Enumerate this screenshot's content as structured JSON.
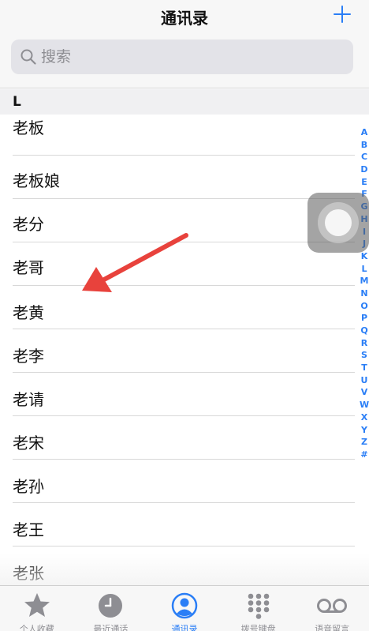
{
  "nav": {
    "title": "通讯录",
    "add_icon": "plus-icon"
  },
  "search": {
    "placeholder": "搜索",
    "value": "",
    "icon": "search-icon"
  },
  "section": {
    "letter": "L"
  },
  "contacts": [
    {
      "name": "老板"
    },
    {
      "name": "老板娘"
    },
    {
      "name": "老分"
    },
    {
      "name": "老哥"
    },
    {
      "name": "老黄"
    },
    {
      "name": "老李"
    },
    {
      "name": "老请"
    },
    {
      "name": "老宋"
    },
    {
      "name": "老孙"
    },
    {
      "name": "老王"
    },
    {
      "name": "老张"
    }
  ],
  "index_letters": [
    "A",
    "B",
    "C",
    "D",
    "E",
    "F",
    "G",
    "H",
    "I",
    "J",
    "K",
    "L",
    "M",
    "N",
    "O",
    "P",
    "Q",
    "R",
    "S",
    "T",
    "U",
    "V",
    "W",
    "X",
    "Y",
    "Z",
    "#"
  ],
  "tabs": [
    {
      "label": "个人收藏",
      "icon": "star-icon",
      "active": false
    },
    {
      "label": "最近通话",
      "icon": "clock-icon",
      "active": false
    },
    {
      "label": "通讯录",
      "icon": "person-circle-icon",
      "active": true
    },
    {
      "label": "拨号键盘",
      "icon": "keypad-icon",
      "active": false
    },
    {
      "label": "语音留言",
      "icon": "voicemail-icon",
      "active": false
    }
  ],
  "colors": {
    "accent": "#2a7ef6",
    "annotation_arrow": "#e8423c",
    "inactive_tab": "#8e8e93"
  }
}
